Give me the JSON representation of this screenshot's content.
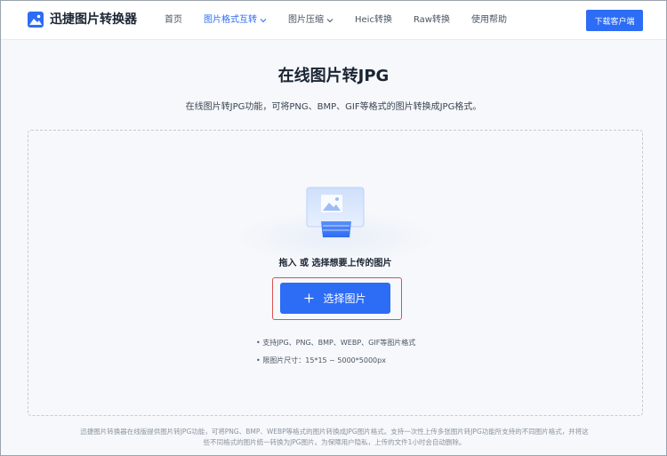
{
  "header": {
    "logo_text": "迅捷图片转换器",
    "nav": [
      {
        "label": "首页",
        "active": false,
        "dropdown": false
      },
      {
        "label": "图片格式互转",
        "active": true,
        "dropdown": true
      },
      {
        "label": "图片压缩",
        "active": false,
        "dropdown": true
      },
      {
        "label": "Heic转换",
        "active": false,
        "dropdown": false
      },
      {
        "label": "Raw转换",
        "active": false,
        "dropdown": false
      },
      {
        "label": "使用帮助",
        "active": false,
        "dropdown": false
      }
    ],
    "download_label": "下载客户端"
  },
  "main": {
    "title": "在线图片转JPG",
    "description": "在线图片转JPG功能，可将PNG、BMP、GIF等格式的图片转换成JPG格式。",
    "drop_hint": "拖入 或 选择想要上传的图片",
    "select_label": "选择图片",
    "features": [
      "• 支持JPG、PNG、BMP、WEBP、GIF等图片格式",
      "• 限图片尺寸：15*15 ~ 5000*5000px"
    ]
  },
  "footer": {
    "line1": "迅捷图片转换器在线版提供图片转JPG功能，可将PNG、BMP、WEBP等格式的图片转换成JPG图片格式。支持一次性上传多张图片转JPG功能所支持的不同图片格式，并将这",
    "line2": "些不同格式的图片统一转换为JPG图片。为保障用户隐私，上传的文件1小时会自动删除。"
  },
  "colors": {
    "accent": "#2d6cf5",
    "highlight_outline": "#d9534f"
  }
}
